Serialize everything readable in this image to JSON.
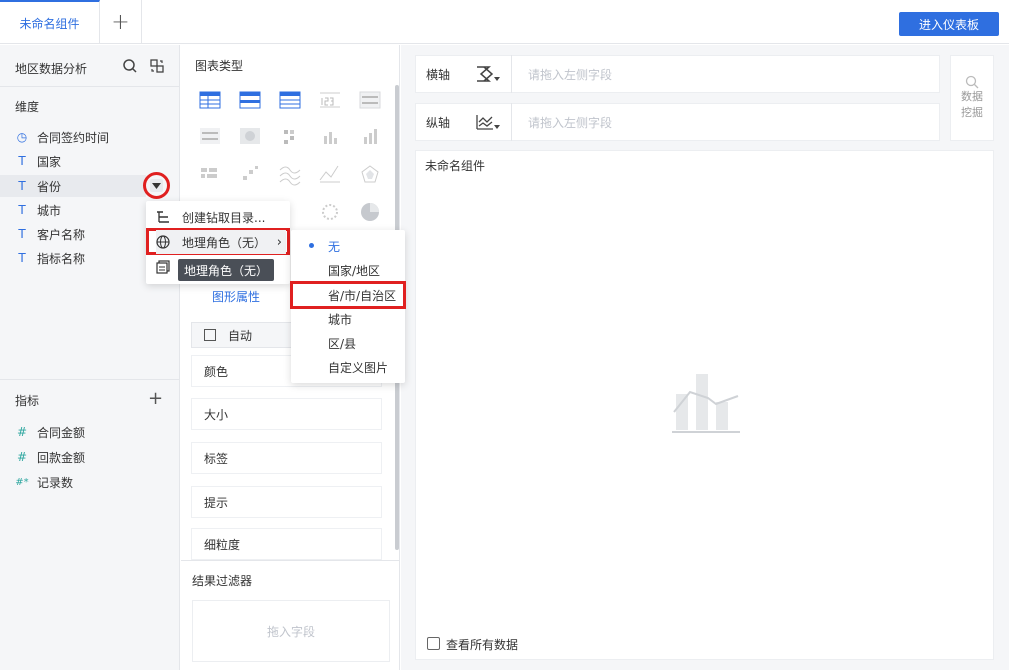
{
  "header": {
    "tab": "未命名组件",
    "add_tab": "+",
    "dashboard_button": "进入仪表板"
  },
  "left_panel": {
    "dataset_name": "地区数据分析",
    "dimensions_title": "维度",
    "dimensions": [
      {
        "icon": "clock-icon",
        "glyph": "◷",
        "label": "合同签约时间"
      },
      {
        "icon": "text-icon",
        "glyph": "T",
        "label": "国家"
      },
      {
        "icon": "text-icon",
        "glyph": "T",
        "label": "省份"
      },
      {
        "icon": "text-icon",
        "glyph": "T",
        "label": "城市"
      },
      {
        "icon": "text-icon",
        "glyph": "T",
        "label": "客户名称"
      },
      {
        "icon": "text-icon",
        "glyph": "T",
        "label": "指标名称"
      }
    ],
    "measures_title": "指标",
    "measures": [
      {
        "icon": "hash-icon",
        "glyph": "#",
        "label": "合同金额"
      },
      {
        "icon": "hash-icon",
        "glyph": "#",
        "label": "回款金额"
      },
      {
        "icon": "hash-star-icon",
        "glyph": "#*",
        "label": "记录数"
      }
    ]
  },
  "middle_panel": {
    "chart_type_title": "图表类型",
    "graphic_props_tab": "图形属性",
    "auto_select": "自动",
    "properties": [
      "颜色",
      "大小",
      "标签",
      "提示",
      "细粒度"
    ],
    "result_filter_title": "结果过滤器",
    "drop_field": "拖入字段"
  },
  "axes": {
    "x_label": "横轴",
    "y_label": "纵轴",
    "x_placeholder": "请拖入左侧字段",
    "y_placeholder": "请拖入左侧字段",
    "mining_1": "数据",
    "mining_2": "挖掘"
  },
  "canvas": {
    "title": "未命名组件",
    "show_all": "查看所有数据"
  },
  "context_menu": {
    "items": [
      "创建钻取目录...",
      "地理角色（无）"
    ],
    "tooltip": "地理角色（无）"
  },
  "submenu": {
    "items": [
      "无",
      "国家/地区",
      "省/市/自治区",
      "城市",
      "区/县",
      "自定义图片"
    ],
    "selected": "无"
  },
  "colors": {
    "accent": "#2f6fe0",
    "highlight_red": "#e02020"
  }
}
